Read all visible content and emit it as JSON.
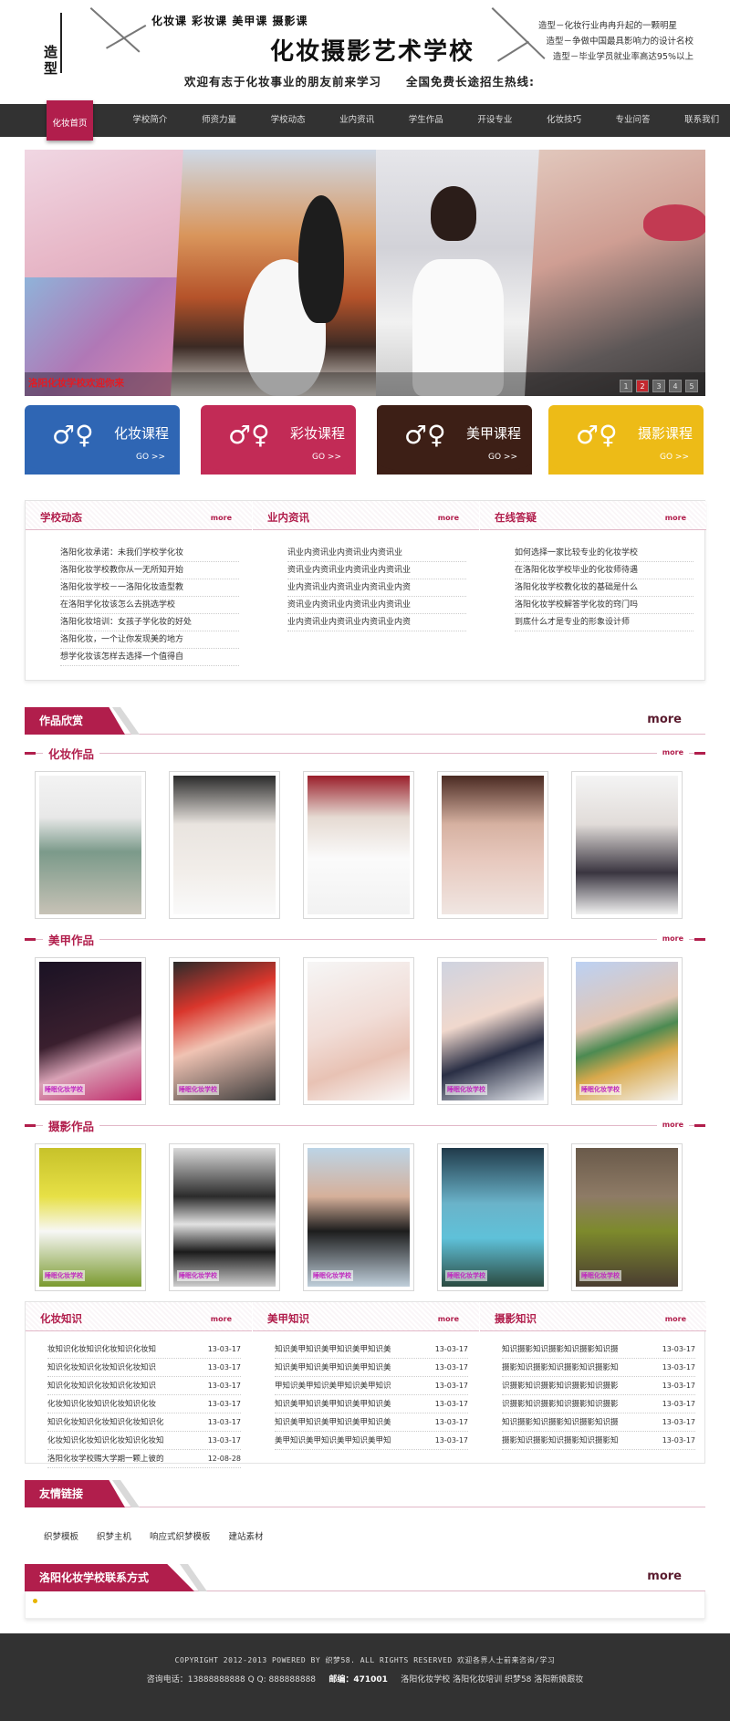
{
  "header": {
    "logo_chars": [
      "造",
      "型"
    ],
    "tagline": "化妆课 彩妆课 美甲课 摄影课",
    "school_name": "化妆摄影艺术学校",
    "welcome": "欢迎有志于化妆事业的朋友前来学习　　全国免费长途招生热线:",
    "right_lines": [
      "造型－化妆行业冉冉升起的一颗明星",
      "造型－争做中国最具影响力的设计名校",
      "造型－毕业学员就业率高达95%以上"
    ]
  },
  "nav": {
    "items": [
      "化妆首页",
      "学校简介",
      "师资力量",
      "学校动态",
      "业内资讯",
      "学生作品",
      "开设专业",
      "化妆技巧",
      "专业问答",
      "联系我们"
    ],
    "active_index": 0
  },
  "banner": {
    "caption": "洛阳化妆学校欢迎你来",
    "pages": [
      "1",
      "2",
      "3",
      "4",
      "5"
    ],
    "active_page": 1
  },
  "courses": [
    {
      "label": "化妆课程",
      "go": "GO >>",
      "symbol": "♂♀",
      "color": "#2f66b4"
    },
    {
      "label": "彩妆课程",
      "go": "GO >>",
      "symbol": "♂♀",
      "color": "#c22b56"
    },
    {
      "label": "美甲课程",
      "go": "GO >>",
      "symbol": "♂♀",
      "color": "#3d1f16"
    },
    {
      "label": "摄影课程",
      "go": "GO >>",
      "symbol": "♂♀",
      "color": "#edbb17"
    }
  ],
  "news": [
    {
      "title": "学校动态",
      "more": "more",
      "items": [
        "洛阳化妆承诺：未我们学校学化妆",
        "洛阳化妆学校教你从一无所知开始",
        "洛阳化妆学校－一洛阳化妆造型教",
        "在洛阳学化妆该怎么去挑选学校",
        "洛阳化妆培训：女孩子学化妆的好处",
        "洛阳化妆，一个让你发现美的地方",
        "想学化妆该怎样去选择一个值得自"
      ]
    },
    {
      "title": "业内资讯",
      "more": "more",
      "items": [
        "讯业内资讯业内资讯业内资讯业",
        "资讯业内资讯业内资讯业内资讯业",
        "业内资讯业内资讯业内资讯业内资",
        "资讯业内资讯业内资讯业内资讯业",
        "业内资讯业内资讯业内资讯业内资"
      ]
    },
    {
      "title": "在线答疑",
      "more": "more",
      "items": [
        "如何选择一家比较专业的化妆学校",
        "在洛阳化妆学校毕业的化妆师待遇",
        "洛阳化妆学校教化妆的基础是什么",
        "洛阳化妆学校解答学化妆的窍门吗",
        "到底什么才是专业的形象设计师"
      ]
    }
  ],
  "works": {
    "title": "作品欣赏",
    "more": "more",
    "groups": [
      {
        "title": "化妆作品",
        "more": "more",
        "watermark": ""
      },
      {
        "title": "美甲作品",
        "more": "more",
        "watermark": "睡眠化妆学校"
      },
      {
        "title": "摄影作品",
        "more": "more",
        "watermark": "睡眠化妆学校"
      }
    ]
  },
  "knowledge": [
    {
      "title": "化妆知识",
      "more": "more",
      "items": [
        {
          "t": "妆知识化妆知识化妆知识化妆知",
          "d": "13-03-17"
        },
        {
          "t": "知识化妆知识化妆知识化妆知识",
          "d": "13-03-17"
        },
        {
          "t": "知识化妆知识化妆知识化妆知识",
          "d": "13-03-17"
        },
        {
          "t": "化妆知识化妆知识化妆知识化妆",
          "d": "13-03-17"
        },
        {
          "t": "知识化妆知识化妆知识化妆知识化",
          "d": "13-03-17"
        },
        {
          "t": "化妆知识化妆知识化妆知识化妆知",
          "d": "13-03-17"
        },
        {
          "t": "洛阳化妆学校赐大学期一颗上彼的",
          "d": "12-08-28"
        }
      ]
    },
    {
      "title": "美甲知识",
      "more": "more",
      "items": [
        {
          "t": "知识美甲知识美甲知识美甲知识美",
          "d": "13-03-17"
        },
        {
          "t": "知识美甲知识美甲知识美甲知识美",
          "d": "13-03-17"
        },
        {
          "t": "甲知识美甲知识美甲知识美甲知识",
          "d": "13-03-17"
        },
        {
          "t": "知识美甲知识美甲知识美甲知识美",
          "d": "13-03-17"
        },
        {
          "t": "知识美甲知识美甲知识美甲知识美",
          "d": "13-03-17"
        },
        {
          "t": "美甲知识美甲知识美甲知识美甲知",
          "d": "13-03-17"
        }
      ]
    },
    {
      "title": "摄影知识",
      "more": "more",
      "items": [
        {
          "t": "知识摄影知识摄影知识摄影知识摄",
          "d": "13-03-17"
        },
        {
          "t": "摄影知识摄影知识摄影知识摄影知",
          "d": "13-03-17"
        },
        {
          "t": "识摄影知识摄影知识摄影知识摄影",
          "d": "13-03-17"
        },
        {
          "t": "识摄影知识摄影知识摄影知识摄影",
          "d": "13-03-17"
        },
        {
          "t": "知识摄影知识摄影知识摄影知识摄",
          "d": "13-03-17"
        },
        {
          "t": "摄影知识摄影知识摄影知识摄影知",
          "d": "13-03-17"
        }
      ]
    }
  ],
  "friend_links": {
    "title": "友情链接",
    "items": [
      "织梦模板",
      "织梦主机",
      "响应式织梦模板",
      "建站素材"
    ]
  },
  "contact": {
    "title": "洛阳化妆学校联系方式",
    "more": "more"
  },
  "footer": {
    "copyright": "COPYRIGHT 2012-2013 POWERED BY 织梦58. ALL RIGHTS RESERVED 欢迎各界人士前来咨询/学习",
    "line2_a": "咨询电话：13888888888 Q Q: 888888888",
    "line2_b": "邮编：471001",
    "line2_c": "洛阳化妆学校 洛阳化妆培训 织梦58 洛阳新娘跟妆"
  },
  "colors": {
    "brand": "#b11e4c",
    "nav_bg": "#323232",
    "footer_bg": "#323232"
  }
}
